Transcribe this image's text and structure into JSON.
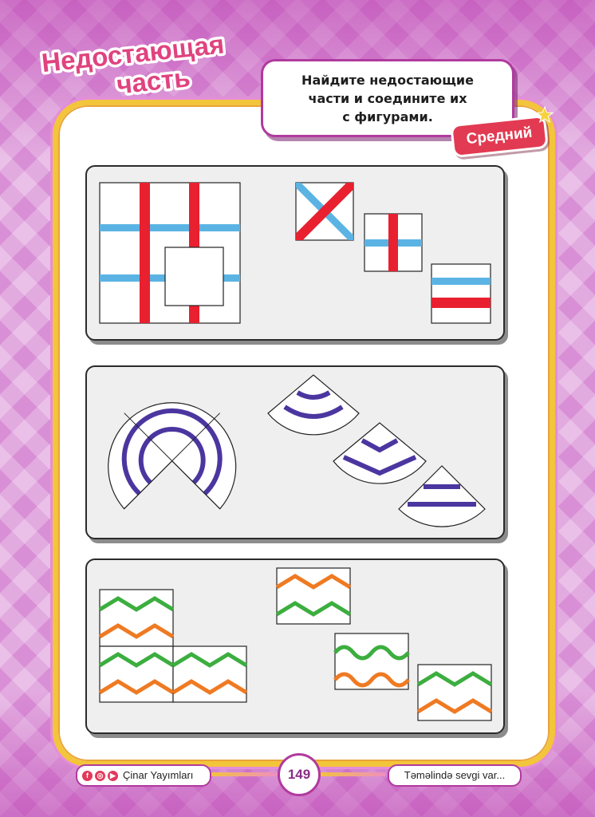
{
  "header": {
    "title_line1": "Недостающая",
    "title_line2": "часть",
    "instruction": "Найдите недостающие\nчасти и соедините их\nс фигурами.",
    "level": "Средний"
  },
  "footer": {
    "publisher": "Çinar Yayımları",
    "page_number": "149",
    "slogan": "Təməlində sevgi var..."
  },
  "colors": {
    "red": "#e8202f",
    "blue": "#5bb3e3",
    "purple": "#4b36a0",
    "green": "#3cae3f",
    "orange": "#ef7a22",
    "title_pink": "#e0437f",
    "accent_magenta": "#b03a9e"
  },
  "icons": {
    "facebook": "facebook-icon",
    "instagram": "instagram-icon",
    "youtube": "youtube-icon",
    "star": "star-icon"
  }
}
